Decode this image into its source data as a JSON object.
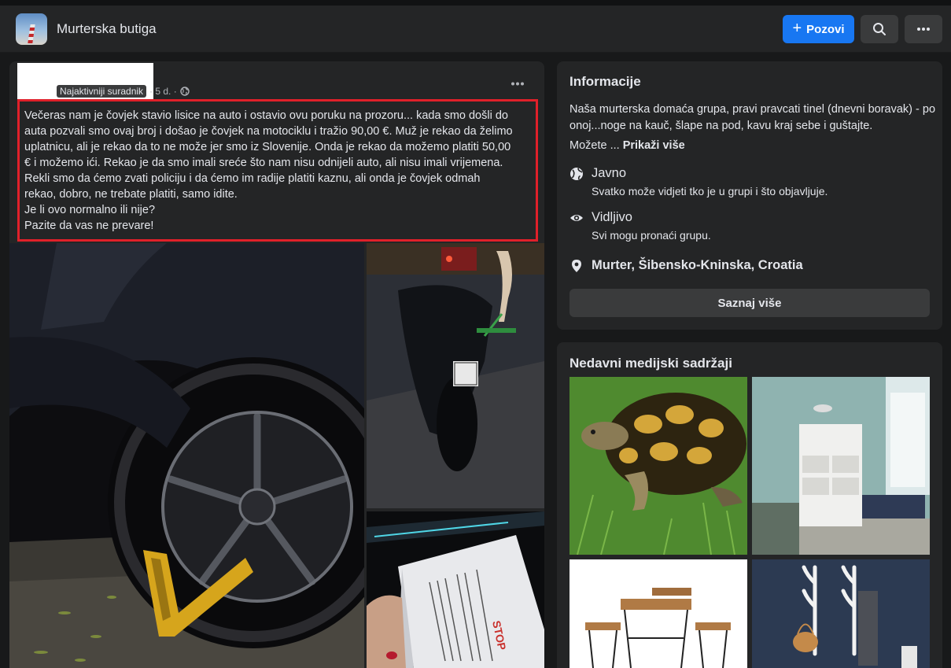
{
  "header": {
    "group_name": "Murterska butiga",
    "invite_label": "Pozovi",
    "invite_icon": "plus-icon",
    "search_icon": "search-icon",
    "more_icon": "more-horizontal-icon",
    "accent_color": "#1877f2"
  },
  "post": {
    "badge": "Najaktivniji suradnik",
    "time": "· 5 d. ·",
    "privacy_icon": "globe-icon",
    "highlight_color": "#e0202a",
    "lines": [
      "Večeras nam je čovjek stavio lisice na auto i ostavio ovu poruku na prozoru... kada smo došli do",
      "auta pozvali smo ovaj broj i došao je čovjek na motociklu i tražio 90,00 €. Muž je rekao da želimo",
      "uplatnicu, ali je rekao da to ne može jer smo iz Slovenije. Onda je rekao da možemo platiti 50,00",
      "€ i možemo ići. Rekao je da smo imali sreće što nam nisu odnijeli auto, ali nisu imali vrijemena.",
      "Rekli smo da ćemo zvati policiju i da ćemo im radije platiti kaznu, ali onda je čovjek odmah",
      "rekao, dobro, ne trebate platiti, samo idite.",
      "Je li ovo normalno ili nije?",
      "Pazite da vas ne prevare!"
    ]
  },
  "about": {
    "title": "Informacije",
    "description": "Naša murterska domaća grupa, pravi pravcati tinel (dnevni boravak) - po onoj...noge na kauč, šlape na pod, kavu kraj sebe i guštajte.",
    "more_prefix": "Možete ...",
    "more_link": "Prikaži više",
    "public_title": "Javno",
    "public_desc": "Svatko može vidjeti tko je u grupi i što objavljuje.",
    "visible_title": "Vidljivo",
    "visible_desc": "Svi mogu pronaći grupu.",
    "location": "Murter, Šibensko-Kninska, Croatia",
    "learn_more": "Saznaj više"
  },
  "media": {
    "title": "Nedavni medijski sadržaji"
  }
}
